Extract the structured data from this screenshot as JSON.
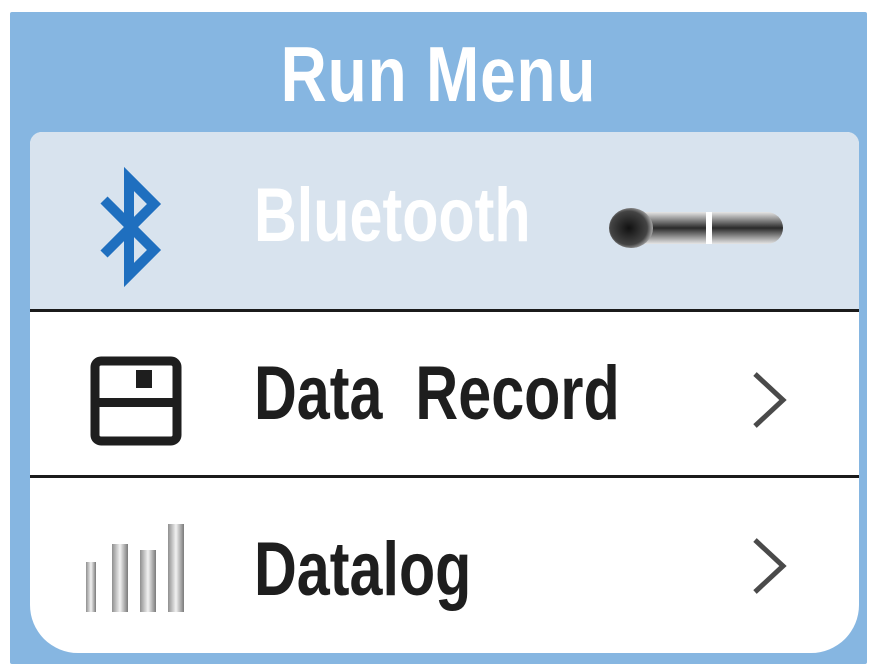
{
  "title": "Run Menu",
  "menu": {
    "items": [
      {
        "label": "Bluetooth",
        "icon": "bluetooth-icon",
        "control": "toggle",
        "state": "off"
      },
      {
        "label": "Data  Record",
        "icon": "floppy-disk-icon",
        "control": "chevron-right-icon"
      },
      {
        "label": "Datalog",
        "icon": "bar-chart-icon",
        "control": "chevron-right-icon"
      }
    ]
  },
  "colors": {
    "background": "#86b6e1",
    "selected_row": "#d8e3ee",
    "bluetooth_icon": "#1f6fbf",
    "text": "#1e1e1e"
  }
}
